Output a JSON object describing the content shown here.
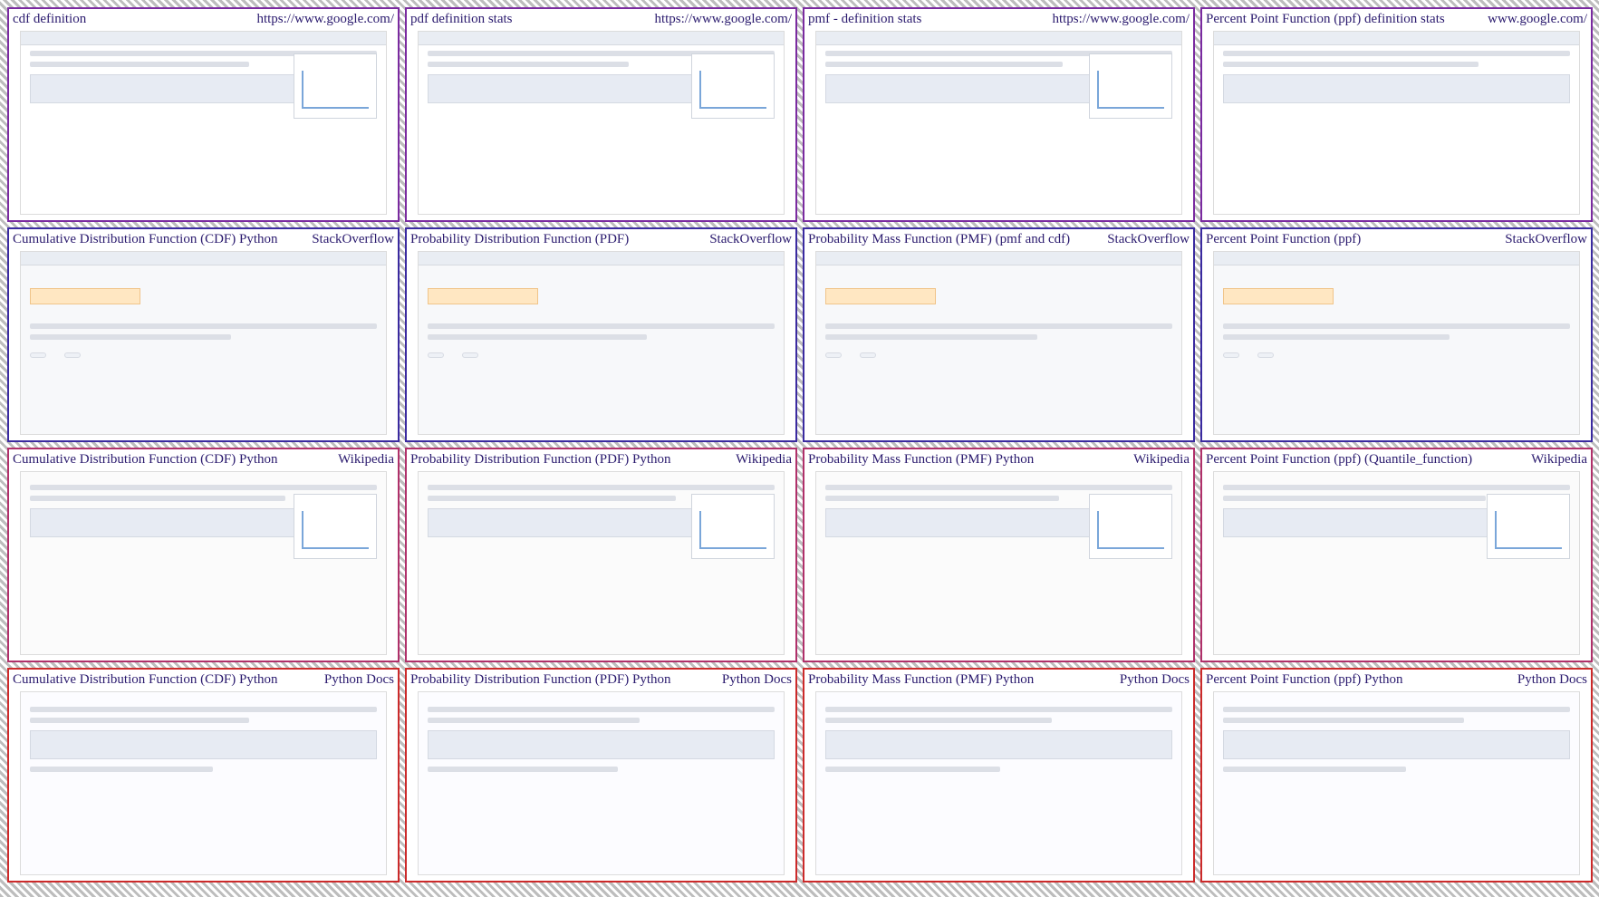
{
  "tiles": [
    {
      "left": "cdf definition",
      "right": "https://www.google.com/"
    },
    {
      "left": "pdf definition stats",
      "right": "https://www.google.com/"
    },
    {
      "left": "pmf - definition stats",
      "right": "https://www.google.com/"
    },
    {
      "left": "Percent Point Function (ppf) definition stats",
      "right": "www.google.com/"
    },
    {
      "left": "Cumulative Distribution Function (CDF) Python",
      "right": "StackOverflow"
    },
    {
      "left": "Probability Distribution Function (PDF)",
      "right": "StackOverflow"
    },
    {
      "left": "Probability Mass Function (PMF) (pmf and cdf)",
      "right": "StackOverflow"
    },
    {
      "left": "Percent Point Function (ppf)",
      "right": "StackOverflow"
    },
    {
      "left": "Cumulative Distribution Function (CDF) Python",
      "right": "Wikipedia"
    },
    {
      "left": "Probability Distribution Function (PDF) Python",
      "right": "Wikipedia"
    },
    {
      "left": "Probability Mass Function (PMF) Python",
      "right": "Wikipedia"
    },
    {
      "left": "Percent Point Function (ppf) (Quantile_function)",
      "right": "Wikipedia"
    },
    {
      "left": "Cumulative Distribution Function (CDF) Python",
      "right": "Python Docs"
    },
    {
      "left": "Probability Distribution Function (PDF) Python",
      "right": "Python Docs"
    },
    {
      "left": "Probability Mass Function (PMF) Python",
      "right": "Python Docs"
    },
    {
      "left": "Percent Point Function (ppf) Python",
      "right": "Python Docs"
    }
  ],
  "border_colors": {
    "row1": "#7a2aa0",
    "row2": "#3a2aa0",
    "row3": "#b0306a",
    "row4": "#cc2a2a"
  }
}
